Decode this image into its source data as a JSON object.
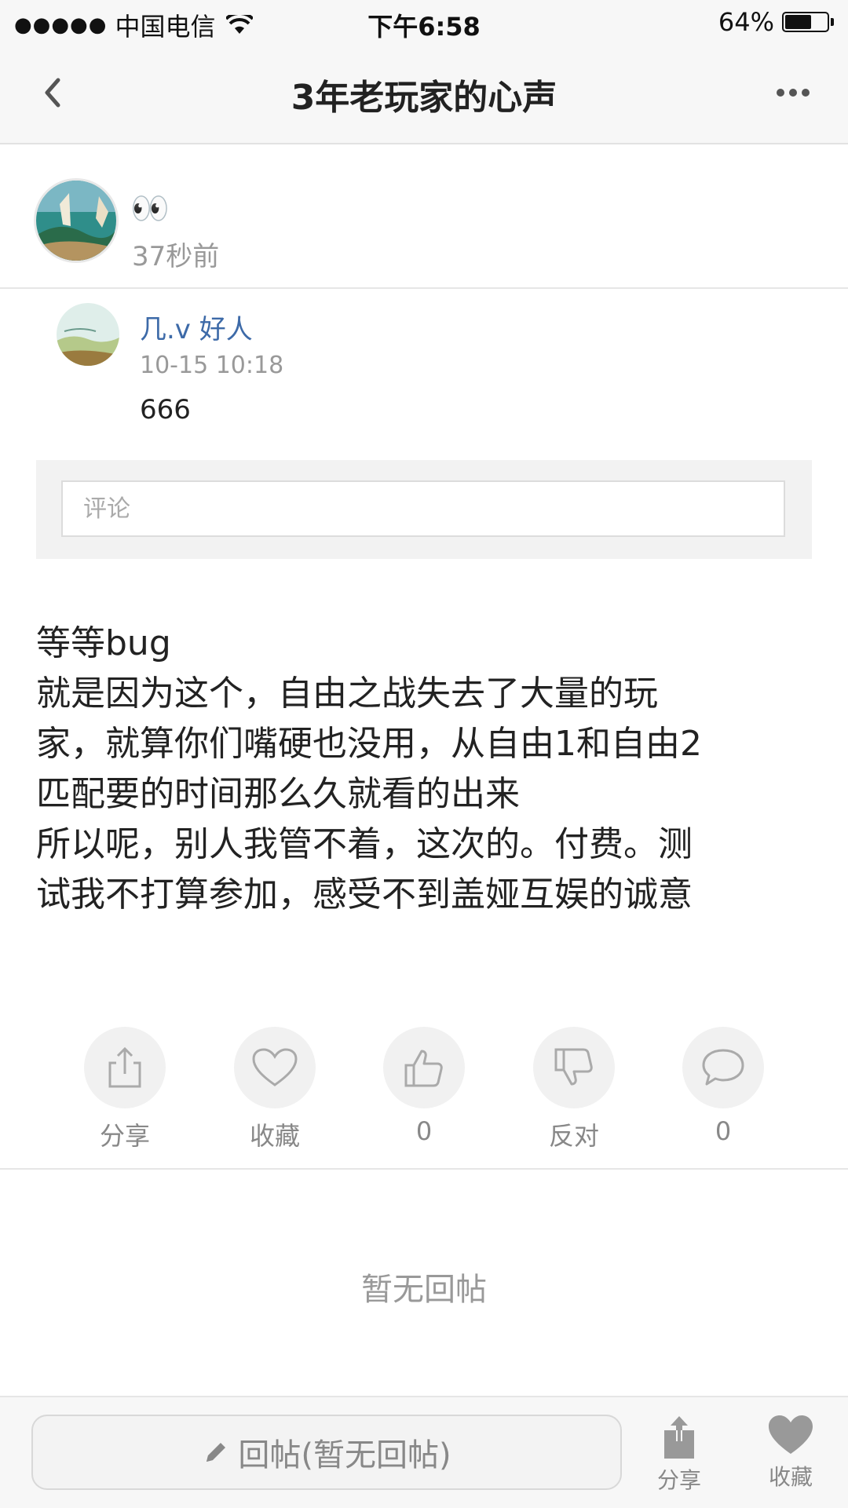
{
  "status_bar": {
    "signal_dots": "●●●●●",
    "carrier": "中国电信",
    "time": "下午6:58",
    "battery_percent": "64%",
    "battery_level": 0.64
  },
  "nav": {
    "title": "3年老玩家的心声"
  },
  "author": {
    "name": "👀",
    "time": "37秒前"
  },
  "comment": {
    "name": "几.v 好人",
    "time": "10-15 10:18",
    "text": "666",
    "input_placeholder": "评论"
  },
  "post": {
    "body": "等等bug\n就是因为这个，自由之战失去了大量的玩\n家，就算你们嘴硬也没用，从自由1和自由2\n匹配要的时间那么久就看的出来\n所以呢，别人我管不着，这次的。付费。测\n试我不打算参加，感受不到盖娅互娱的诚意"
  },
  "actions": {
    "share": "分享",
    "favorite": "收藏",
    "like_count": "0",
    "oppose": "反对",
    "comment_count": "0"
  },
  "replies": {
    "empty_text": "暂无回帖"
  },
  "bottom_bar": {
    "reply_label": "回帖(暂无回帖)",
    "share": "分享",
    "favorite": "收藏"
  },
  "colors": {
    "link_blue": "#3d6aa8",
    "muted_gray": "#999999"
  }
}
